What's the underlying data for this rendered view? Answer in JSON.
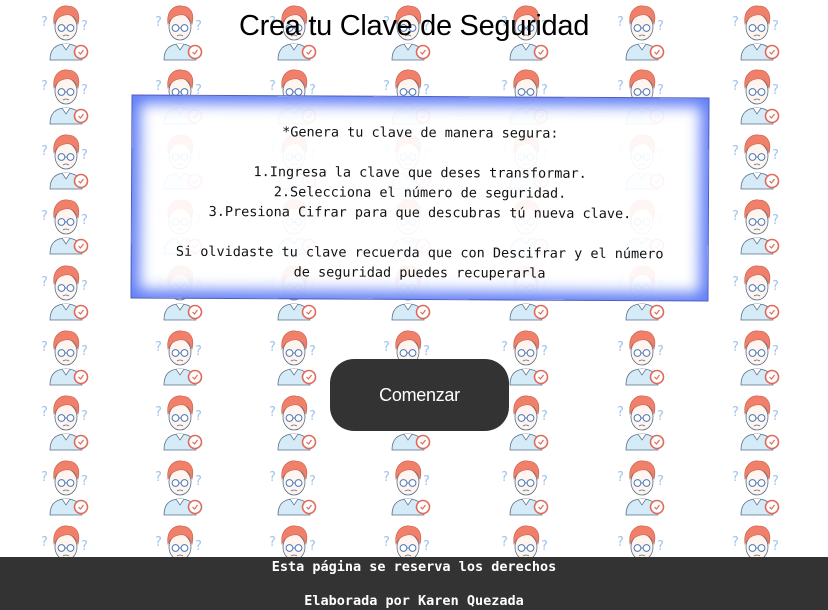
{
  "page": {
    "title": "Crea tu Clave de Seguridad",
    "background_pattern": "cartoon-avatar-question-marks",
    "background_color": "#ffffff"
  },
  "instructions": {
    "lines": [
      "*Genera tu clave de manera segura:",
      "",
      "1.Ingresa la clave que deses transformar.",
      "2.Selecciona el número de seguridad.",
      "3.Presiona Cifrar para que descubras tú nueva clave.",
      "",
      "Si olvidaste tu clave recuerda que con Descifrar y el número",
      "de seguridad puedes recuperarla"
    ],
    "glow_color": "#4669f5"
  },
  "start_button": {
    "label": "Comenzar",
    "color": "#333333"
  },
  "footer": {
    "line1": "Esta página se reserva los derechos",
    "line2": "Elaborada por Karen Quezada",
    "color": "#333333"
  }
}
